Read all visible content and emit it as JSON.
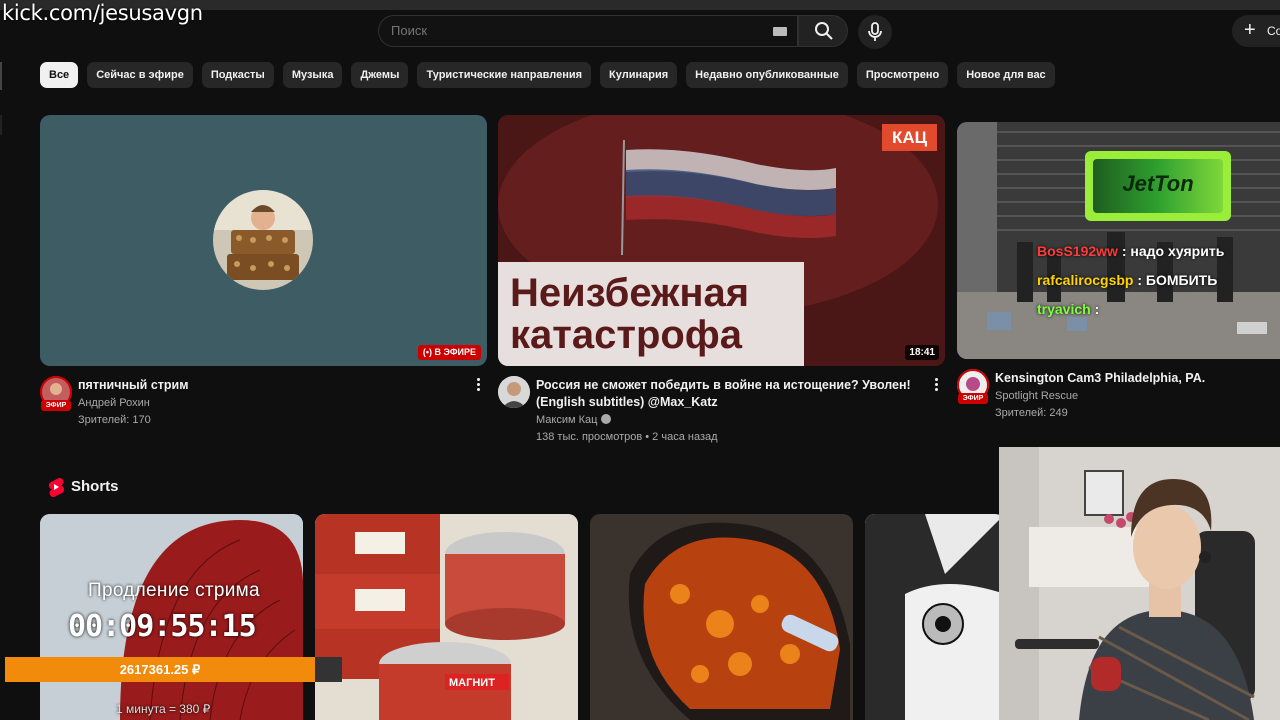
{
  "overlay": {
    "url": "kick.com/jesusavgn"
  },
  "header": {
    "search_placeholder": "Поиск",
    "create_label": "Со"
  },
  "chips": [
    "Все",
    "Сейчас в эфире",
    "Подкасты",
    "Музыка",
    "Джемы",
    "Туристические направления",
    "Кулинария",
    "Недавно опубликованные",
    "Просмотрено",
    "Новое для вас"
  ],
  "videos": [
    {
      "title": "пятничный стрим",
      "channel": "Андрей Рохин",
      "stats": "Зрителей: 170",
      "badge": "В ЭФИРЕ",
      "avatar_badge": "ЭФИР"
    },
    {
      "title_line1": "Россия не сможет победить в войне на истощение? Уволен!",
      "title_line2": "(English subtitles) @Max_Katz",
      "channel": "Максим Кац",
      "stats": "138 тыс. просмотров • 2 часа назад",
      "duration": "18:41",
      "thumb_text_line1": "Неизбежная",
      "thumb_text_line2": "катастрофа",
      "thumb_logo": "КАЦ"
    },
    {
      "title": "Kensington Cam3  Philadelphia, PA.",
      "channel": "Spotlight Rescue",
      "stats": "Зрителей: 249",
      "avatar_badge": "ЭФИР",
      "sponsor_logo": "JetTon",
      "chat": [
        {
          "user": "BosS192ww",
          "text": ": надо хуярить",
          "color": "#ff3b3b"
        },
        {
          "user": "rafcalirocgsbp",
          "text": ": БОМБИТЬ",
          "color": "#ffd400"
        },
        {
          "user": "tryavich",
          "text": ":",
          "color": "#7cff3b"
        }
      ]
    }
  ],
  "shorts": {
    "label": "Shorts"
  },
  "stream_overlay": {
    "extend_label": "Продление стрима",
    "timer": "00:09:55:15",
    "amount": "2617361.25 ₽",
    "rate": "1 минута = 380 ₽",
    "progress": 0.92
  },
  "colors": {
    "accent_red": "#cc0000",
    "progress_orange": "#f28b0c",
    "bg": "#0f0f0f",
    "chip_bg": "#272727"
  }
}
